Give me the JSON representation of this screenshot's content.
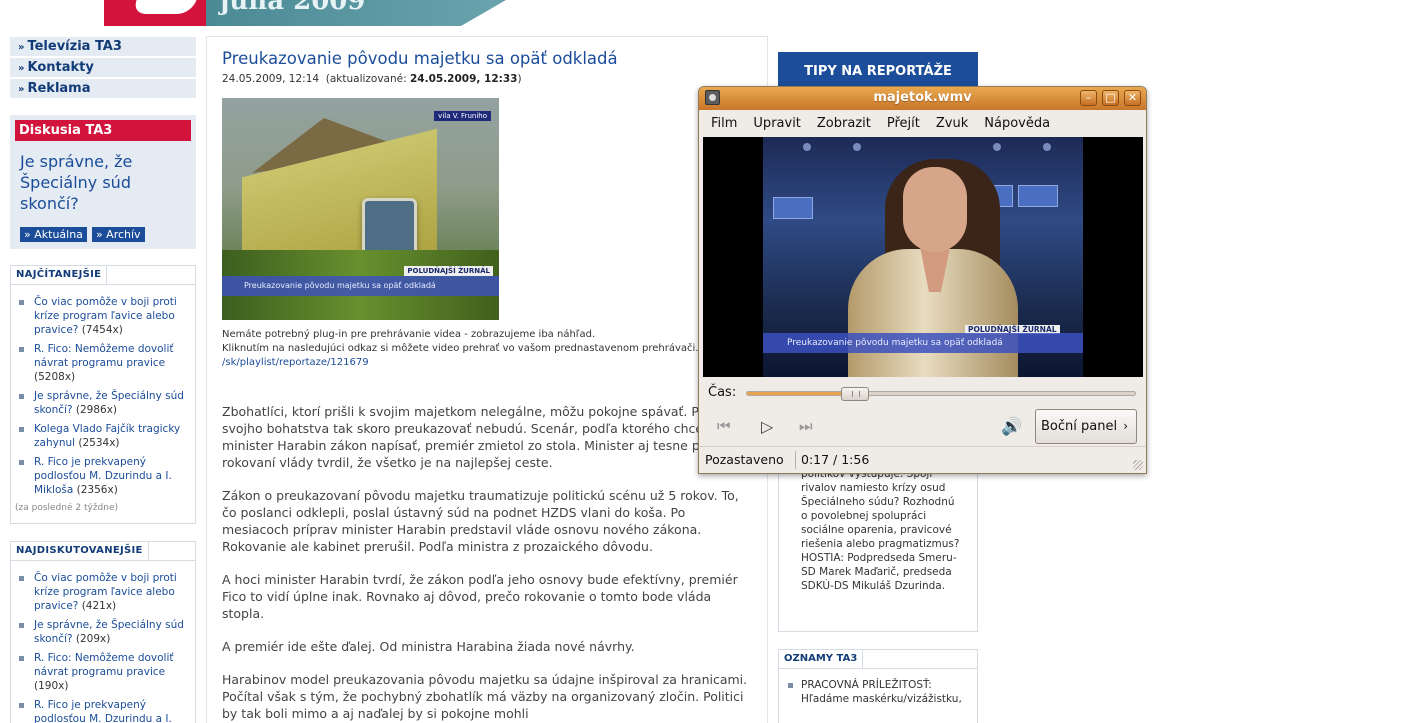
{
  "banner": {
    "text": "júna 2009"
  },
  "left_nav": [
    {
      "label": "Televízia TA3"
    },
    {
      "label": "Kontakty"
    },
    {
      "label": "Reklama"
    }
  ],
  "discussion": {
    "header": "Diskusia TA3",
    "question": "Je správne, že Špeciálny súd skončí?",
    "buttons": [
      "Aktuálna",
      "Archív"
    ]
  },
  "most_read": {
    "title": "NAJČÍTANEJŠIE",
    "items": [
      {
        "text": "Čo viac pomôže v boji proti kríze program ľavice alebo pravice?",
        "count": "(7454x)"
      },
      {
        "text": "R. Fico: Nemôžeme dovoliť návrat programu pravice",
        "count": "(5208x)"
      },
      {
        "text": "Je správne, že Špeciálny súd skončí?",
        "count": "(2986x)"
      },
      {
        "text": "Kolega Vlado Fajčík tragicky zahynul",
        "count": "(2534x)"
      },
      {
        "text": "R. Fico je prekvapený podlosťou M. Dzurindu a I. Mikloša",
        "count": "(2356x)"
      }
    ],
    "note": "(za posledné 2 týždne)"
  },
  "most_discussed": {
    "title": "NAJDISKUTOVANEJŠIE",
    "items": [
      {
        "text": "Čo viac pomôže v boji proti kríze program ľavice alebo pravice?",
        "count": "(421x)"
      },
      {
        "text": "Je správne, že Špeciálny súd skončí?",
        "count": "(209x)"
      },
      {
        "text": "R. Fico: Nemôžeme dovoliť návrat programu pravice",
        "count": "(190x)"
      },
      {
        "text": "R. Fico je prekvapený podlosťou M. Dzurindu a I. Mikloša",
        "count": ""
      }
    ]
  },
  "article": {
    "title": "Preukazovanie pôvodu majetku sa opäť odkladá",
    "date": "24.05.2009, 12:14",
    "updated_label": "(aktualizované:",
    "updated_value": "24.05.2009, 12:33",
    "updated_close": ")",
    "thumb_tag": "vila V. Fruniho",
    "thumb_label": "POLUDŇAJŠÍ ŽURNÁL",
    "thumb_strip": "Preukazovanie pôvodu majetku sa opäť odkladá",
    "plugin_line1": "Nemáte potrebný plug-in pre prehrávanie videa - zobrazujeme iba náhľad.",
    "plugin_line2": "Kliknutím na nasledujúci odkaz si môžete video prehrať vo vašom prednastavenom prehrávači.",
    "plugin_link": "/sk/playlist/reportaze/121679",
    "paragraphs": [
      "Zbohatlíci, ktorí prišli k svojim majetkom nelegálne, môžu pokojne spávať. Pôvod svojho bohatstva tak skoro preukazovať nebudú. Scenár, podľa ktorého chcel minister Harabin zákon napísať, premiér zmietol zo stola. Minister aj tesne po rokovaní vlády tvrdil, že všetko je na najlepšej ceste.",
      "Zákon o preukazovaní pôvodu majetku traumatizuje politickú scénu už 5 rokov. To, čo poslanci odklepli, poslal ústavný súd na podnet HZDS vlani do koša. Po mesiacoch príprav minister Harabin predstavil vláde osnovu nového zákona. Rokovanie ale kabinet prerušil. Podľa ministra z prozaického dôvodu.",
      "A hoci minister Harabin tvrdí, že zákon podľa jeho osnovy bude efektívny, premiér Fico to vidí úplne inak. Rovnako aj dôvod, prečo rokovanie o tomto bode vláda stopla.",
      "A premiér ide ešte ďalej. Od ministra Harabina žiada nové návrhy.",
      "Harabinov model preukazovania pôvodu majetku sa údajne inšpiroval za hranicami. Počítal však s tým, že pochybný zbohatlík má väzby na organizovaný zločin. Politici by tak boli mimo a aj naďalej by si pokojne mohli"
    ]
  },
  "right": {
    "tips_title": "TIPY NA REPORTÁŽE",
    "text": "politikov vystupuje. Spojí rivalov namiesto krízy osud Špeciálneho súdu? Rozhodnú o povolebnej spolupráci sociálne oparenia, pravicové riešenia alebo pragmatizmus? HOSTIA: Podpredseda Smeru-SD Marek Maďarič, predseda SDKÚ-DS Mikuláš Dzurinda.",
    "oznamy_title": "OZNAMY TA3",
    "oznamy_text": "PRACOVNÁ PRÍLEŽITOSŤ: Hľadáme maskérku/vizážistku,"
  },
  "player": {
    "title": "majetok.wmv",
    "menu": [
      "Film",
      "Upravit",
      "Zobrazit",
      "Přejít",
      "Zvuk",
      "Nápověda"
    ],
    "video_label": "POLUDŇAJŠÍ ŽURNÁL",
    "video_strip": "Preukazovanie pôvodu majetku sa opäť odkladá",
    "seek_label": "Čas:",
    "progress": 0.15,
    "sidebar_button": "Boční panel",
    "status": "Pozastaveno",
    "time": "0:17 / 1:56"
  }
}
